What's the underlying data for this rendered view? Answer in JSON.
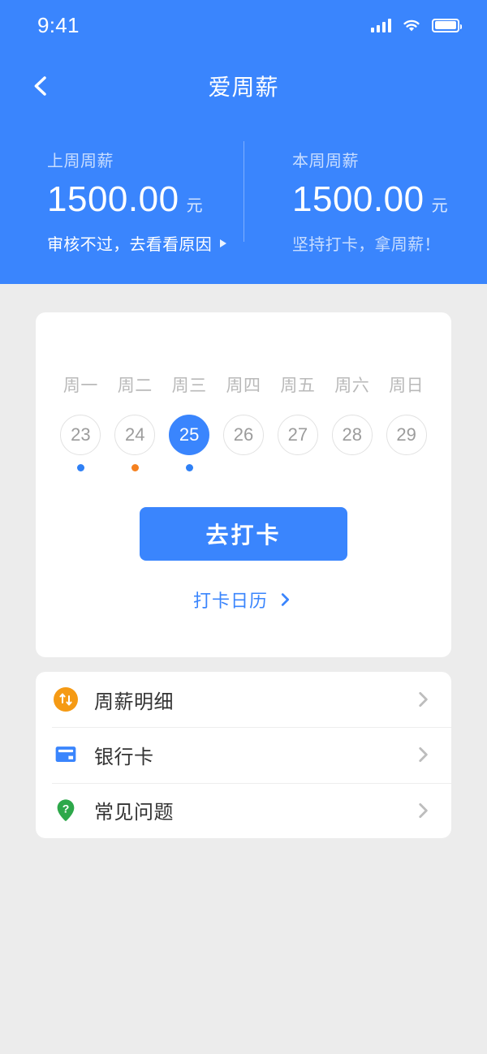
{
  "status_bar": {
    "time": "9:41",
    "signal_icon": "signal-bars-icon",
    "wifi_icon": "wifi-icon",
    "battery_icon": "battery-icon"
  },
  "navbar": {
    "title": "爱周薪",
    "back_icon": "chevron-left-icon"
  },
  "summary": {
    "last_week": {
      "label": "上周周薪",
      "amount": "1500.00",
      "unit": "元",
      "note": "审核不过，去看看原因",
      "note_arrow_icon": "triangle-right-icon"
    },
    "this_week": {
      "label": "本周周薪",
      "amount": "1500.00",
      "unit": "元",
      "note": "坚持打卡，拿周薪！"
    }
  },
  "checkin_card": {
    "weekdays": [
      "周一",
      "周二",
      "周三",
      "周四",
      "周五",
      "周六",
      "周日"
    ],
    "dates": [
      {
        "day": "23",
        "selected": false,
        "dot": "blue"
      },
      {
        "day": "24",
        "selected": false,
        "dot": "orange"
      },
      {
        "day": "25",
        "selected": true,
        "dot": "blue"
      },
      {
        "day": "26",
        "selected": false,
        "dot": "none"
      },
      {
        "day": "27",
        "selected": false,
        "dot": "none"
      },
      {
        "day": "28",
        "selected": false,
        "dot": "none"
      },
      {
        "day": "29",
        "selected": false,
        "dot": "none"
      }
    ],
    "button_label": "去打卡",
    "calendar_link_label": "打卡日历",
    "calendar_link_icon": "chevron-right-icon"
  },
  "menu": {
    "items": [
      {
        "label": "周薪明细",
        "icon": "salary-detail-icon",
        "chevron_icon": "chevron-right-icon"
      },
      {
        "label": "银行卡",
        "icon": "bank-card-icon",
        "chevron_icon": "chevron-right-icon"
      },
      {
        "label": "常见问题",
        "icon": "faq-question-pin-icon",
        "chevron_icon": "chevron-right-icon"
      }
    ]
  },
  "colors": {
    "brand_blue": "#3a85fd",
    "dot_blue": "#2f80f5",
    "dot_orange": "#f5811f",
    "page_bg": "#ececec",
    "icon_orange": "#f59a14",
    "icon_green": "#2da84a",
    "icon_blue": "#3a85fd"
  }
}
